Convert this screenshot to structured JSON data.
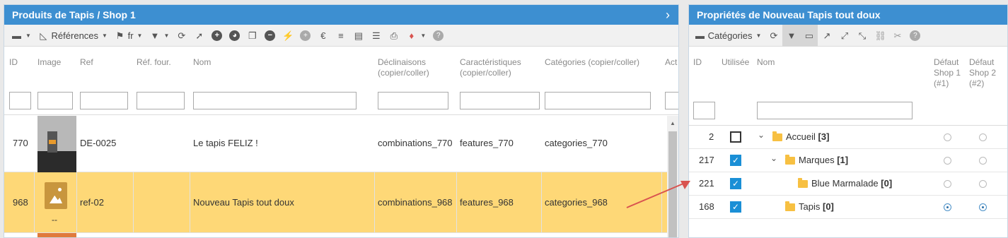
{
  "left": {
    "title": "Produits de Tapis / Shop 1",
    "toolbar": {
      "references_label": "Références",
      "lang_label": "fr"
    },
    "columns": {
      "id": "ID",
      "image": "Image",
      "ref": "Ref",
      "ref_four": "Réf. four.",
      "nom": "Nom",
      "declinaisons_1": "Déclinaisons",
      "declinaisons_2": "(copier/coller)",
      "caracteristiques_1": "Caractéristiques",
      "caracteristiques_2": "(copier/coller)",
      "categories": "Catégories (copier/coller)",
      "act": "Act"
    },
    "rows": [
      {
        "id": "770",
        "ref": "DE-0025",
        "nom": "Le tapis FELIZ !",
        "decl": "combinations_770",
        "carac": "features_770",
        "cat": "categories_770"
      },
      {
        "id": "968",
        "ref": "ref-02",
        "nom": "Nouveau Tapis tout doux",
        "decl": "combinations_968",
        "carac": "features_968",
        "cat": "categories_968",
        "image_caption": "--"
      }
    ]
  },
  "right": {
    "title": "Propriétés de Nouveau Tapis tout doux",
    "toolbar": {
      "categories_label": "Catégories"
    },
    "columns": {
      "id": "ID",
      "used": "Utilisée",
      "nom": "Nom",
      "def1_a": "Défaut",
      "def1_b": "Shop 1",
      "def1_c": "(#1)",
      "def2_a": "Défaut",
      "def2_b": "Shop 2",
      "def2_c": "(#2)"
    },
    "tree": [
      {
        "id": "2",
        "name": "Accueil",
        "count": "[3]",
        "checked": false,
        "shop1": false,
        "shop2": false
      },
      {
        "id": "217",
        "name": "Marques",
        "count": "[1]",
        "checked": true,
        "shop1": false,
        "shop2": false
      },
      {
        "id": "221",
        "name": "Blue Marmalade",
        "count": "[0]",
        "checked": true,
        "shop1": false,
        "shop2": false
      },
      {
        "id": "168",
        "name": "Tapis",
        "count": "[0]",
        "checked": true,
        "shop1": true,
        "shop2": true
      }
    ]
  },
  "colors": {
    "titlebar": "#3d8fd1",
    "selected_row": "#fed877",
    "checkbox": "#1a8fd6",
    "arrow": "#d9534f"
  }
}
